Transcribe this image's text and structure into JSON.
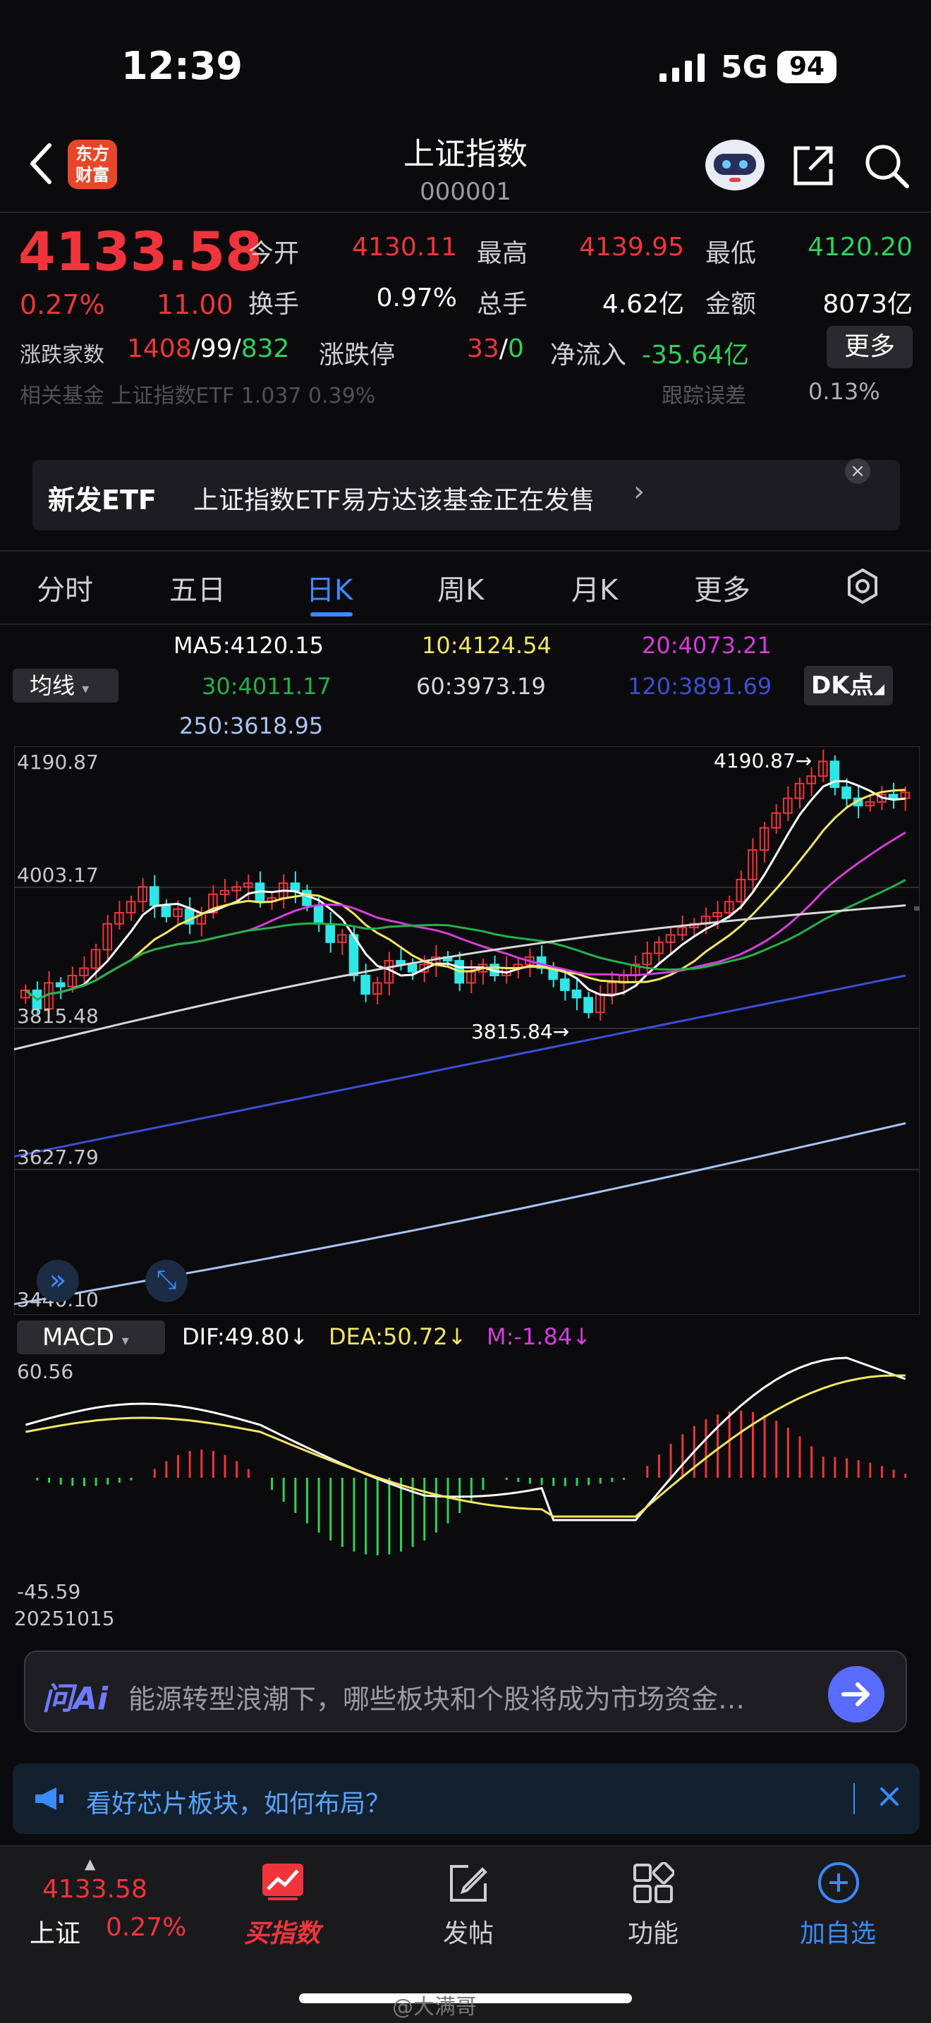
{
  "status": {
    "time": "12:39",
    "network": "5G",
    "battery": "94"
  },
  "header": {
    "title": "上证指数",
    "code": "000001",
    "logo_text": "东方\n财富"
  },
  "quote": {
    "price": "4133.58",
    "pct": "0.27%",
    "change": "11.00",
    "open_label": "今开",
    "open": "4130.11",
    "high_label": "最高",
    "high": "4139.95",
    "low_label": "最低",
    "low": "4120.20",
    "turnover_label": "换手",
    "turnover": "0.97%",
    "volume_label": "总手",
    "volume": "4.62亿",
    "amount_label": "金额",
    "amount": "8073亿",
    "updown_label": "涨跌家数",
    "up_count": "1408",
    "flat_count": "99",
    "down_count": "832",
    "limit_label": "涨跌停",
    "limit_up": "33",
    "limit_down": "0",
    "netflow_label": "净流入",
    "netflow": "-35.64亿",
    "more": "更多"
  },
  "fund": {
    "row": "相关基金  上证指数ETF  1.037  0.39%",
    "track_label": "跟踪误差",
    "track_value": "0.13%"
  },
  "banner": {
    "tag": "新发ETF",
    "text": "上证指数ETF易方达该基金正在发售",
    "close": "×"
  },
  "tabs": [
    "分时",
    "五日",
    "日K",
    "周K",
    "月K",
    "更多"
  ],
  "ma_select": "均线",
  "dk_button": "DK点",
  "ma": {
    "ma5": "MA5:4120.15",
    "ma10": "10:4124.54",
    "ma20": "20:4073.21",
    "ma30": "30:4011.17",
    "ma60": "60:3973.19",
    "ma120": "120:3891.69",
    "ma250": "250:3618.95"
  },
  "kline": {
    "y_labels": [
      "4190.87",
      "4003.17",
      "3815.48",
      "3627.79",
      "3440.10"
    ],
    "high_marker": "4190.87",
    "low_marker": "3815.84"
  },
  "macd": {
    "select": "MACD",
    "dif": "DIF:49.80",
    "dea": "DEA:50.72",
    "m": "M:-1.84",
    "top": "60.56",
    "bottom": "-45.59",
    "start_date": "20251015"
  },
  "ask": {
    "logo": "问Ai",
    "text": "能源转型浪潮下，哪些板块和个股将成为市场资金…"
  },
  "news": {
    "text": "看好芯片板块，如何布局？"
  },
  "nav": {
    "index_price": "4133.58",
    "index_name": "上证",
    "index_pct": "0.27%",
    "buy": "买指数",
    "post": "发帖",
    "func": "功能",
    "watch": "加自选"
  },
  "watermark": "@大满哥",
  "colors": {
    "up": "#f0343c",
    "down": "#2ed15a",
    "accent": "#3a8bff",
    "ma5": "#ffffff",
    "ma10": "#f5e663",
    "ma20": "#d63ddb",
    "ma30": "#22b24a",
    "ma60": "#d8d8d8",
    "ma120": "#3b4fd6",
    "ma250": "#a8c4f5"
  }
}
